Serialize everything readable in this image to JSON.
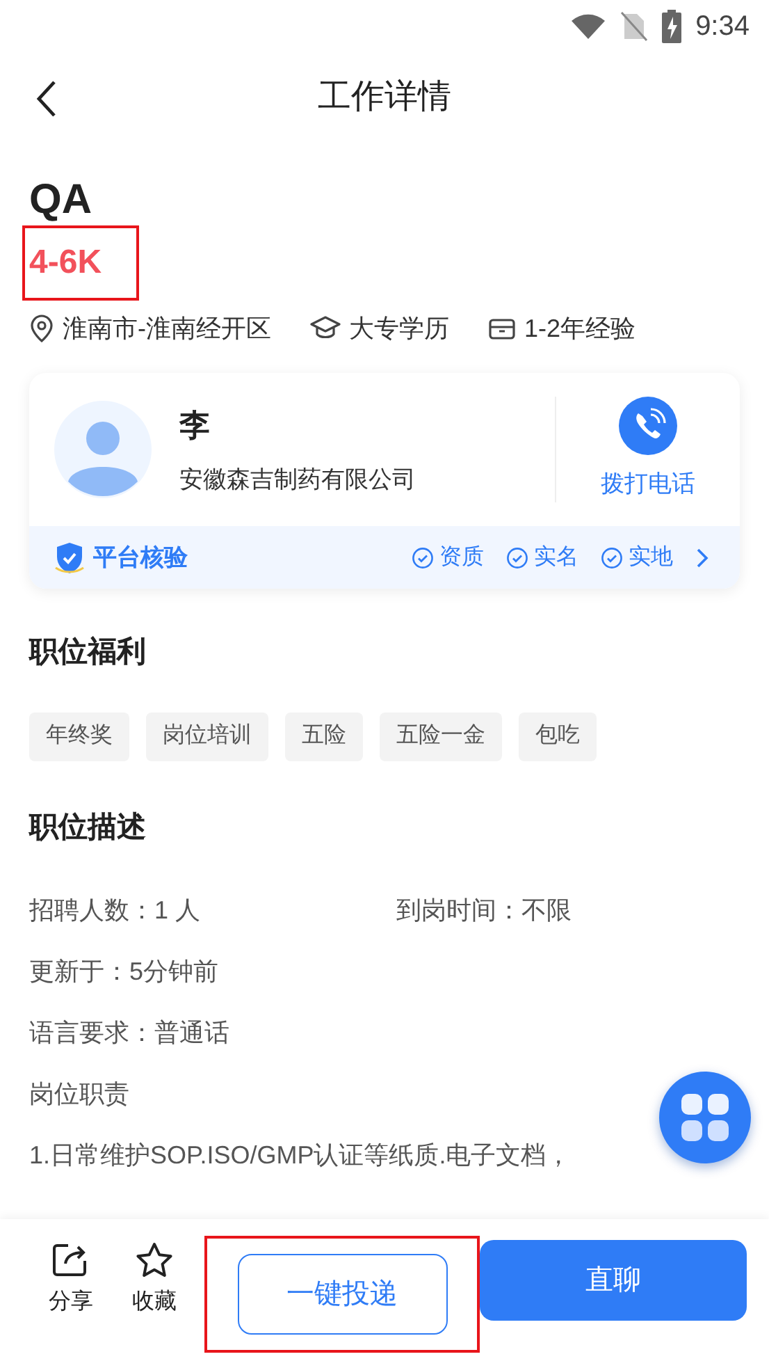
{
  "status_bar": {
    "time": "9:34"
  },
  "header": {
    "title": "工作详情"
  },
  "job": {
    "title": "QA",
    "salary": {
      "text": "4-6K",
      "highlighted": true
    },
    "meta": [
      {
        "kind": "location",
        "text": "淮南市-淮南经开区"
      },
      {
        "kind": "education",
        "text": "大专学历"
      },
      {
        "kind": "experience",
        "text": "1-2年经验"
      }
    ]
  },
  "contact_card": {
    "name": "李",
    "company": "安徽森吉制药有限公司",
    "call_label": "拨打电话",
    "verify_title": "平台核验",
    "checks": [
      "资质",
      "实名",
      "实地"
    ]
  },
  "benefits": {
    "heading": "职位福利",
    "tags": [
      "年终奖",
      "岗位培训",
      "五险",
      "五险一金",
      "包吃"
    ]
  },
  "description": {
    "heading": "职位描述",
    "facts": [
      [
        "招聘人数：1 人",
        "到岗时间：不限"
      ],
      [
        "更新于：5分钟前"
      ],
      [
        "语言要求：普通话"
      ]
    ],
    "duties_heading": "岗位职责",
    "duties": [
      "1.日常维护SOP.ISO/GMP认证等纸质.电子文档，"
    ]
  },
  "bottom_bar": {
    "actions": [
      {
        "kind": "share",
        "label": "分享"
      },
      {
        "kind": "favorite",
        "label": "收藏"
      }
    ],
    "apply": {
      "label": "一键投递",
      "highlighted": true
    },
    "chat": {
      "label": "直聊"
    }
  }
}
